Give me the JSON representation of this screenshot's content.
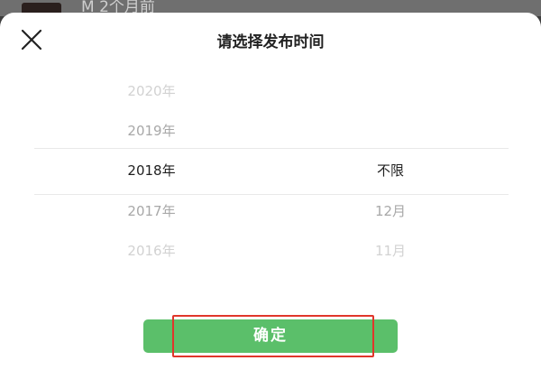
{
  "background_item": {
    "text": "M  2个月前"
  },
  "dialog": {
    "title": "请选择发布时间",
    "close_icon": "close-icon"
  },
  "picker": {
    "years": [
      "2020年",
      "2019年",
      "2018年",
      "2017年",
      "2016年"
    ],
    "months": [
      "不限",
      "12月",
      "11月"
    ],
    "selected_year": "2018年",
    "selected_month": "不限"
  },
  "confirm_button": {
    "label": "确定"
  },
  "colors": {
    "confirm": "#5bbf6a",
    "annotation_box": "#e0362b",
    "selected_text": "#1f1f1f"
  }
}
